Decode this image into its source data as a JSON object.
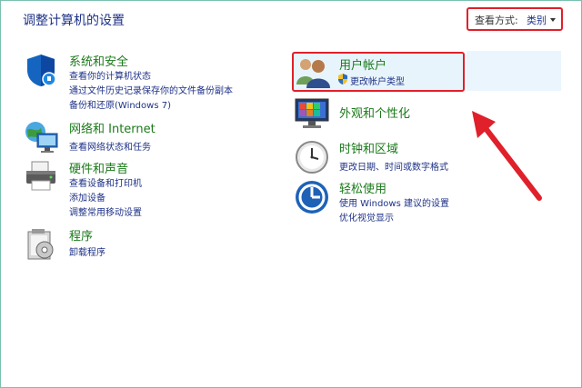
{
  "title": "调整计算机的设置",
  "view_by": {
    "label": "查看方式:",
    "value": "类别"
  },
  "left_categories": [
    {
      "head": "系统和安全",
      "links": [
        "查看你的计算机状态",
        "通过文件历史记录保存你的文件备份副本",
        "备份和还原(Windows 7)"
      ],
      "icon": "shield-icon"
    },
    {
      "head": "网络和 Internet",
      "links": [
        "查看网络状态和任务"
      ],
      "icon": "network-icon"
    },
    {
      "head": "硬件和声音",
      "links": [
        "查看设备和打印机",
        "添加设备",
        "调整常用移动设置"
      ],
      "icon": "printer-icon"
    },
    {
      "head": "程序",
      "links": [
        "卸载程序"
      ],
      "icon": "programs-icon"
    }
  ],
  "right_categories": [
    {
      "head": "用户帐户",
      "links": [
        "更改帐户类型"
      ],
      "icon": "users-icon"
    },
    {
      "head": "外观和个性化",
      "links": [],
      "icon": "display-icon"
    },
    {
      "head": "时钟和区域",
      "links": [
        "更改日期、时间或数字格式"
      ],
      "icon": "clock-icon"
    },
    {
      "head": "轻松使用",
      "links": [
        "使用 Windows 建议的设置",
        "优化视觉显示"
      ],
      "icon": "accessibility-icon"
    }
  ],
  "colors": {
    "accent_red": "#e0202a",
    "heading_green": "#1a7a1a",
    "link_blue": "#1e3287"
  }
}
